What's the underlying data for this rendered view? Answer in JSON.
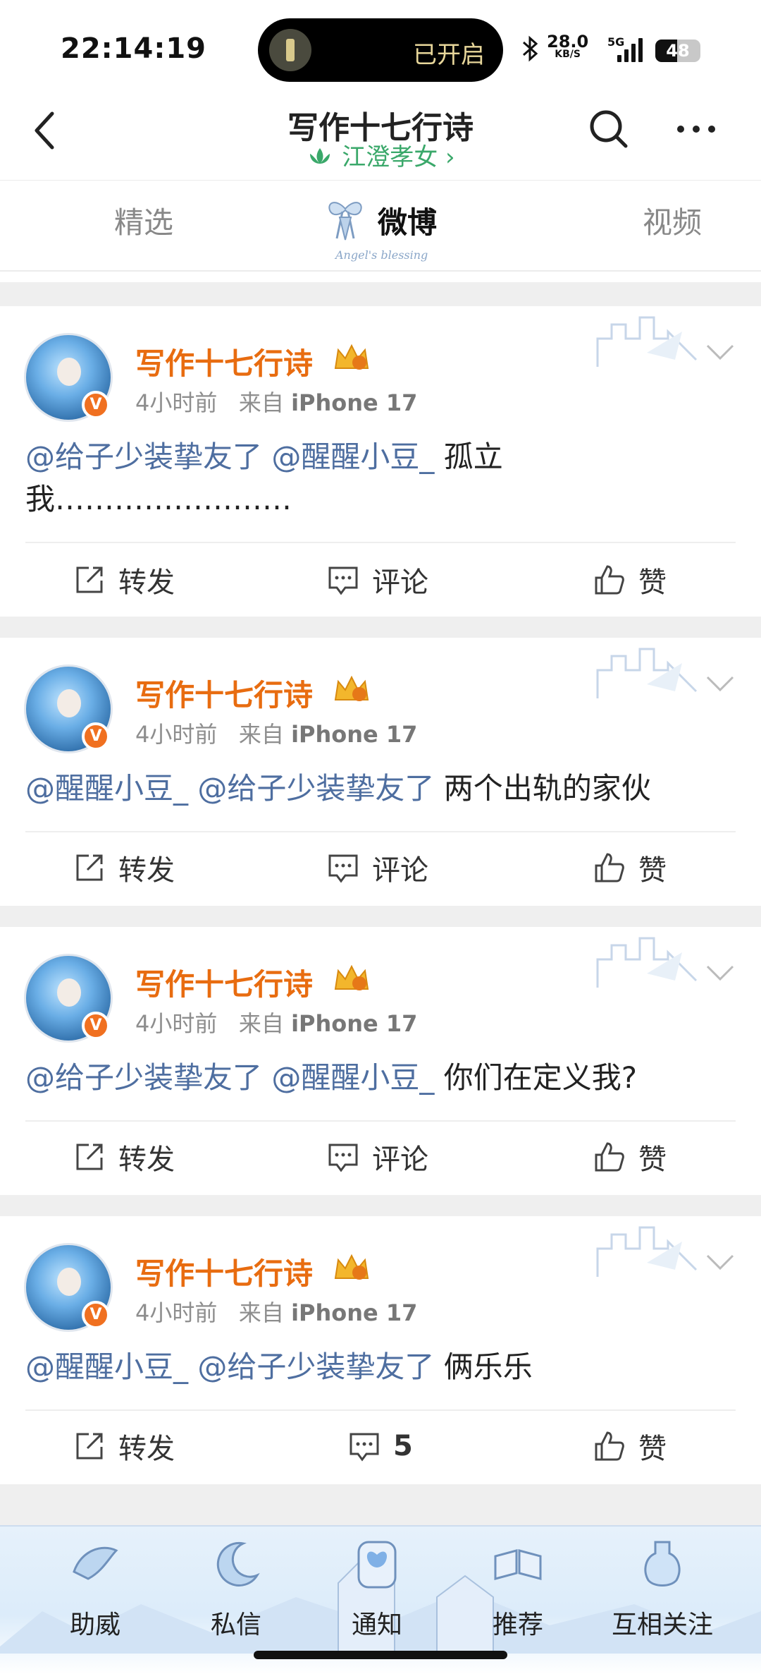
{
  "status_bar": {
    "time": "22:14:19",
    "island_text": "已开启",
    "net_speed": "28.0",
    "net_unit": "KB/S",
    "signal_label": "5G",
    "battery": "48",
    "battery_level": 0.48
  },
  "nav": {
    "title": "写作十七行诗",
    "subtitle": "江澄孝女 ›"
  },
  "tabs": [
    {
      "label": "精选"
    },
    {
      "label": "微博"
    },
    {
      "label": "视频"
    }
  ],
  "tab_deco_text": "Angel's blessing",
  "posts": [
    {
      "author": "写作十七行诗",
      "time": "4小时前",
      "source_prefix": "来自",
      "source": "iPhone 17",
      "mention1": "@给子少装挚友了",
      "mention2": "@醒醒小豆_",
      "text_rest": " 孤立我……………………",
      "repost": "转发",
      "comment": "评论",
      "like": "赞"
    },
    {
      "author": "写作十七行诗",
      "time": "4小时前",
      "source_prefix": "来自",
      "source": "iPhone 17",
      "mention1": "@醒醒小豆_",
      "mention2": "@给子少装挚友了",
      "text_rest": " 两个出轨的家伙",
      "repost": "转发",
      "comment": "评论",
      "like": "赞"
    },
    {
      "author": "写作十七行诗",
      "time": "4小时前",
      "source_prefix": "来自",
      "source": "iPhone 17",
      "mention1": "@给子少装挚友了",
      "mention2": "@醒醒小豆_",
      "text_rest": " 你们在定义我?",
      "repost": "转发",
      "comment": "评论",
      "like": "赞"
    },
    {
      "author": "写作十七行诗",
      "time": "4小时前",
      "source_prefix": "来自",
      "source": "iPhone 17",
      "mention1": "@醒醒小豆_",
      "mention2": "@给子少装挚友了",
      "text_rest": " 俩乐乐",
      "repost": "转发",
      "comment": "5",
      "like": "赞"
    }
  ],
  "bottom_bar": [
    {
      "label": "助威"
    },
    {
      "label": "私信"
    },
    {
      "label": "通知"
    },
    {
      "label": "推荐"
    },
    {
      "label": "互相关注"
    }
  ],
  "colors": {
    "author": "#e86c10",
    "mention": "#4e6ea0",
    "subtitle_green": "#3aa86a"
  }
}
